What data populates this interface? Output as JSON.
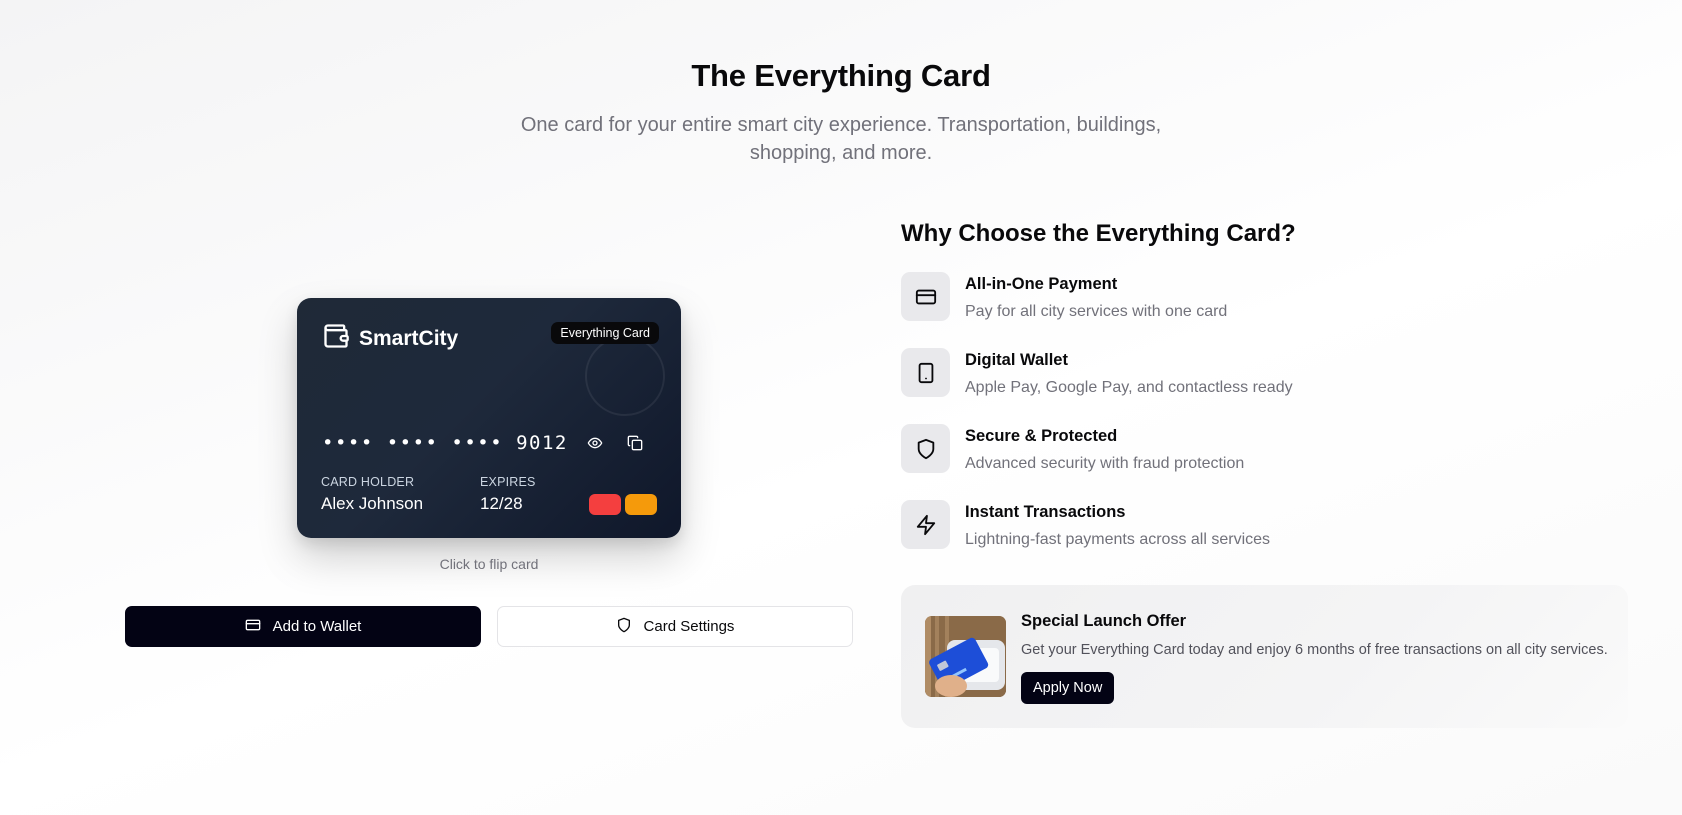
{
  "hero": {
    "title": "The Everything Card",
    "subtitle": "One card for your entire smart city experience. Transportation, buildings, shopping, and more."
  },
  "card": {
    "brand_icon": "wallet-icon",
    "brand_name": "SmartCity",
    "badge": "Everything Card",
    "number_masked": "•••• •••• •••• 9012",
    "reveal_icon": "eye-icon",
    "copy_icon": "copy-icon",
    "holder_label": "CARD HOLDER",
    "holder_name": "Alex Johnson",
    "expires_label": "EXPIRES",
    "expires_value": "12/28",
    "chip_colors": [
      "#f43f3f",
      "#f59a0b"
    ],
    "flip_hint": "Click to flip card"
  },
  "actions": {
    "add_wallet": {
      "label": "Add to Wallet",
      "icon": "credit-card-icon"
    },
    "card_settings": {
      "label": "Card Settings",
      "icon": "shield-icon"
    }
  },
  "why": {
    "title": "Why Choose the Everything Card?",
    "features": [
      {
        "icon": "credit-card-icon",
        "title": "All-in-One Payment",
        "desc": "Pay for all city services with one card"
      },
      {
        "icon": "smartphone-icon",
        "title": "Digital Wallet",
        "desc": "Apple Pay, Google Pay, and contactless ready"
      },
      {
        "icon": "shield-icon",
        "title": "Secure & Protected",
        "desc": "Advanced security with fraud protection"
      },
      {
        "icon": "zap-icon",
        "title": "Instant Transactions",
        "desc": "Lightning-fast payments across all services"
      }
    ]
  },
  "offer": {
    "title": "Special Launch Offer",
    "desc": "Get your Everything Card today and enjoy 6 months of free transactions on all city services.",
    "button": "Apply Now"
  },
  "colors": {
    "primary": "#030314",
    "muted_text": "#71717a",
    "card_bg": "#1e293b"
  }
}
